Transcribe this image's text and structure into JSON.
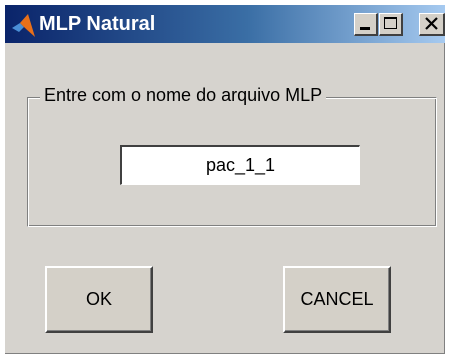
{
  "window": {
    "title": "MLP Natural",
    "icon": "matlab-icon",
    "controls": {
      "minimize": "minimize-icon",
      "maximize": "maximize-icon",
      "close": "close-icon"
    }
  },
  "form": {
    "group_label": "Entre com o nome do arquivo MLP",
    "filename_value": "pac_1_1"
  },
  "buttons": {
    "ok_label": "OK",
    "cancel_label": "CANCEL"
  },
  "colors": {
    "title_bar_start": "#0a246a",
    "title_bar_end": "#a6caf0",
    "dialog_face": "#d6d3ce",
    "icon_orange": "#e8701a"
  }
}
